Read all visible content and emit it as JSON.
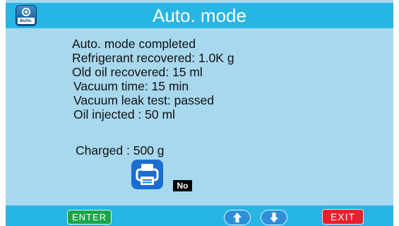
{
  "header": {
    "title": "Auto. mode",
    "icon": "auto-mode-icon",
    "icon_caption": "Auto."
  },
  "results": {
    "lines": [
      "Auto. mode completed",
      "Refrigerant recovered: 1.0K g",
      "Old oil recovered: 15 ml",
      "Vacuum time: 15 min",
      "Vacuum leak test: passed",
      "Oil injected : 50 ml"
    ],
    "charged": "Charged : 500 g"
  },
  "print": {
    "icon": "printer-icon",
    "choice": "No"
  },
  "footer": {
    "enter_label": "ENTER",
    "up_icon": "arrow-up-icon",
    "down_icon": "arrow-down-icon",
    "exit_label": "EXIT"
  },
  "colors": {
    "title_bar": "#27b5e3",
    "screen_background": "#a8d8ee",
    "enter_button": "#1aa64a",
    "exit_button": "#e81f2d",
    "arrow_buttons": "#2b8fd9",
    "printer_button": "#1a6dd1"
  }
}
